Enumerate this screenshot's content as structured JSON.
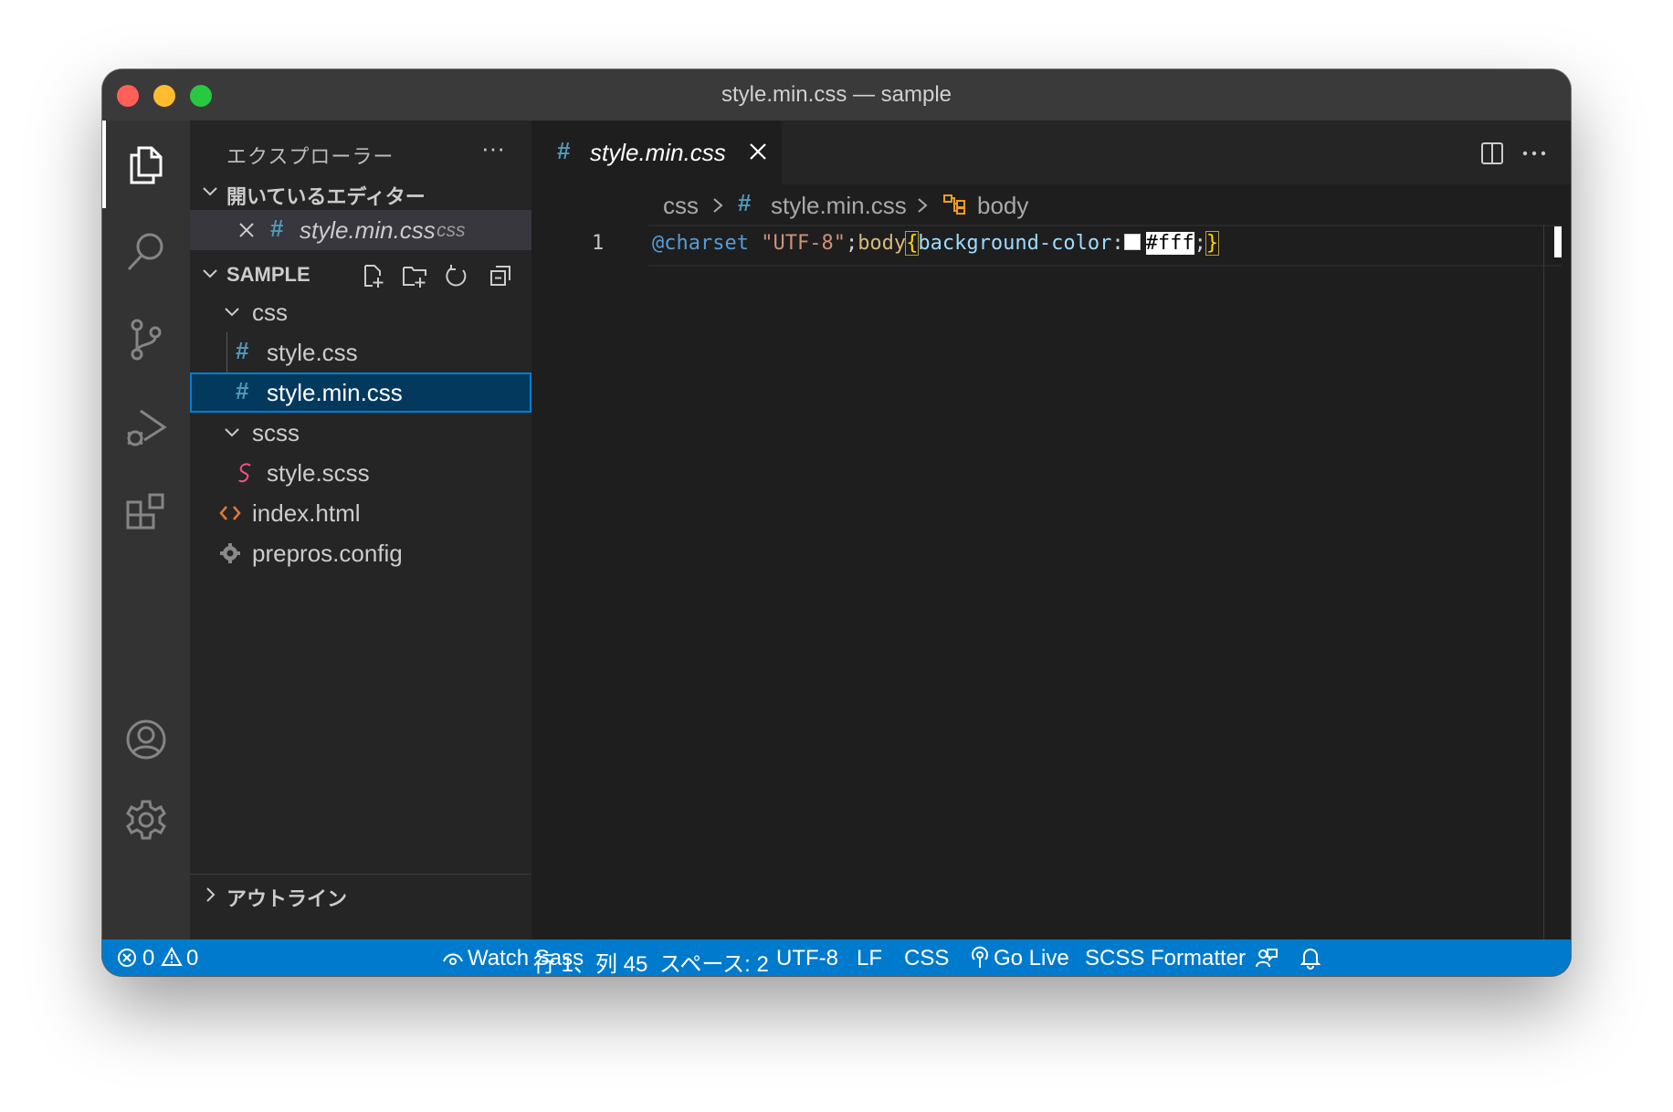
{
  "window": {
    "title": "style.min.css — sample"
  },
  "activity_bar": {
    "items": [
      "explorer-icon",
      "search-icon",
      "source-control-icon",
      "run-debug-icon",
      "extensions-icon"
    ],
    "bottom": [
      "account-icon",
      "settings-gear-icon"
    ]
  },
  "sidebar": {
    "title": "エクスプローラー",
    "more": "···",
    "open_editors": {
      "label": "開いているエディター",
      "items": [
        {
          "name": "style.min.css",
          "folder": "css"
        }
      ]
    },
    "project": {
      "label": "SAMPLE",
      "tree": [
        {
          "label": "css"
        },
        {
          "label": "style.css"
        },
        {
          "label": "style.min.css"
        },
        {
          "label": "scss"
        },
        {
          "label": "style.scss"
        },
        {
          "label": "index.html"
        },
        {
          "label": "prepros.config"
        }
      ]
    },
    "outline": {
      "label": "アウトライン"
    }
  },
  "editor": {
    "tab": {
      "label": "style.min.css"
    },
    "breadcrumb": [
      "css",
      "style.min.css",
      "body"
    ],
    "lines": [
      {
        "number": "1",
        "tokens": [
          {
            "text": "@charset",
            "color": "#569cd6"
          },
          {
            "text": " ",
            "color": "#d4d4d4"
          },
          {
            "text": "\"UTF-8\"",
            "color": "#ce9178"
          },
          {
            "text": ";",
            "color": "#d4d4d4"
          },
          {
            "text": "body",
            "color": "#d7ba7d"
          },
          {
            "text": "{",
            "color": "#ffd700"
          },
          {
            "text": "background-color",
            "color": "#9cdcfe"
          },
          {
            "text": ":",
            "color": "#d4d4d4"
          },
          {
            "text": "#fff",
            "color": "#000000"
          },
          {
            "text": ";",
            "color": "#d4d4d4"
          },
          {
            "text": "}",
            "color": "#ffd700"
          }
        ],
        "color_swatch": "#ffffff"
      }
    ]
  },
  "statusbar": {
    "errors": "0",
    "warnings": "0",
    "watch": "Watch Sass",
    "position": "行 1、列 45",
    "spaces": "スペース: 2",
    "encoding": "UTF-8",
    "eol": "LF",
    "language": "CSS",
    "golive": "Go Live",
    "formatter": "SCSS Formatter"
  }
}
